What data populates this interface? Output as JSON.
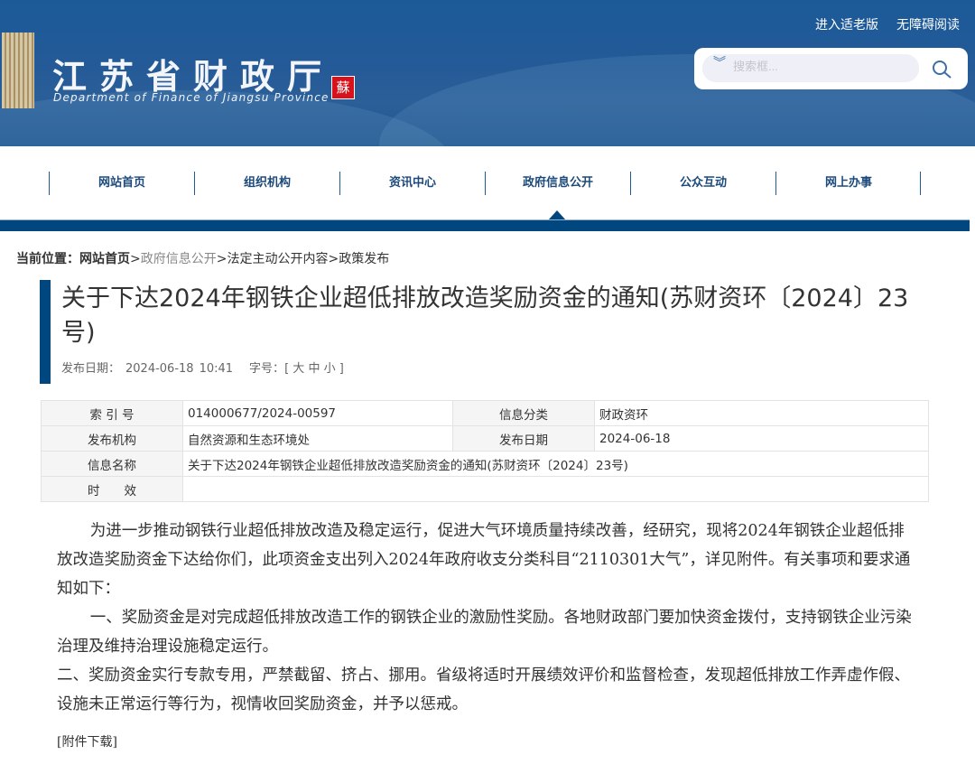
{
  "header": {
    "logo_cn": "江苏省财政厅",
    "logo_en": "Department of Finance of Jiangsu Province",
    "seal": "蘇",
    "elder_mode": "进入适老版",
    "accessible": "无障碍阅读",
    "search_placeholder": "搜索框..."
  },
  "nav": [
    "网站首页",
    "组织机构",
    "资讯中心",
    "政府信息公开",
    "公众互动",
    "网上办事"
  ],
  "breadcrumb": {
    "label": "当前位置：",
    "home": "网站首页",
    "sep": ">",
    "items": [
      "政府信息公开",
      "法定主动公开内容",
      "政策发布"
    ]
  },
  "article": {
    "title": "关于下达2024年钢铁企业超低排放改造奖励资金的通知(苏财资环〔2024〕23号)",
    "date_label": "发布日期：",
    "date": "2024-06-18",
    "time": "10:41",
    "font_label": "字号：",
    "font_sizes": [
      "大",
      "中",
      "小"
    ]
  },
  "info": {
    "index_label": "索 引 号",
    "index": "014000677/2024-00597",
    "category_label": "信息分类",
    "category": "财政资环",
    "org_label": "发布机构",
    "org": "自然资源和生态环境处",
    "pubdate_label": "发布日期",
    "pubdate": "2024-06-18",
    "name_label": "信息名称",
    "name": "关于下达2024年钢铁企业超低排放改造奖励资金的通知(苏财资环〔2024〕23号)",
    "validity_label": "时　　效",
    "validity": ""
  },
  "body": [
    "为进一步推动钢铁行业超低排放改造及稳定运行，促进大气环境质量持续改善，经研究，现将2024年钢铁企业超低排放改造奖励资金下达给你们，此项资金支出列入2024年政府收支分类科目“2110301大气”，详见附件。有关事项和要求通知如下：",
    "一、奖励资金是对完成超低排放改造工作的钢铁企业的激励性奖励。各地财政部门要加快资金拨付，支持钢铁企业污染治理及维持治理设施稳定运行。",
    "二、奖励资金实行专款专用，严禁截留、挤占、挪用。省级将适时开展绩效评价和监督检查，发现超低排放工作弄虚作假、设施未正常运行等行为，视情收回奖励资金，并予以惩戒。"
  ],
  "attachment": "[附件下载]"
}
